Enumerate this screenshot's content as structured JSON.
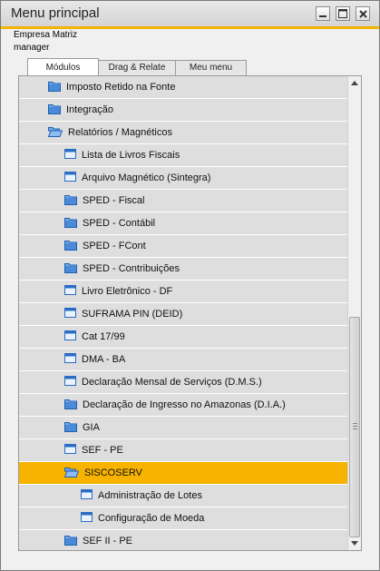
{
  "window": {
    "title": "Menu principal"
  },
  "info": {
    "company": "Empresa Matriz",
    "user": "manager"
  },
  "tabs": [
    {
      "label": "Módulos",
      "active": true
    },
    {
      "label": "Drag & Relate",
      "active": false
    },
    {
      "label": "Meu menu",
      "active": false
    }
  ],
  "tree": [
    {
      "label": "Imposto Retido na Fonte",
      "level": 1,
      "icon": "folder-icon"
    },
    {
      "label": "Integração",
      "level": 1,
      "icon": "folder-icon"
    },
    {
      "label": "Relatórios / Magnéticos",
      "level": 1,
      "icon": "folder-open-icon"
    },
    {
      "label": "Lista de Livros Fiscais",
      "level": 2,
      "icon": "form-icon"
    },
    {
      "label": "Arquivo Magnético (Sintegra)",
      "level": 2,
      "icon": "form-icon"
    },
    {
      "label": "SPED - Fiscal",
      "level": 2,
      "icon": "folder-icon"
    },
    {
      "label": "SPED - Contábil",
      "level": 2,
      "icon": "folder-icon"
    },
    {
      "label": "SPED - FCont",
      "level": 2,
      "icon": "folder-icon"
    },
    {
      "label": "SPED - Contribuições",
      "level": 2,
      "icon": "folder-icon"
    },
    {
      "label": "Livro Eletrônico - DF",
      "level": 2,
      "icon": "form-icon"
    },
    {
      "label": "SUFRAMA PIN (DEID)",
      "level": 2,
      "icon": "form-icon"
    },
    {
      "label": "Cat 17/99",
      "level": 2,
      "icon": "form-icon"
    },
    {
      "label": "DMA - BA",
      "level": 2,
      "icon": "form-icon"
    },
    {
      "label": "Declaração Mensal de Serviços (D.M.S.)",
      "level": 2,
      "icon": "form-icon"
    },
    {
      "label": "Declaração de Ingresso no Amazonas (D.I.A.)",
      "level": 2,
      "icon": "folder-icon"
    },
    {
      "label": "GIA",
      "level": 2,
      "icon": "folder-icon"
    },
    {
      "label": "SEF - PE",
      "level": 2,
      "icon": "form-icon"
    },
    {
      "label": "SISCOSERV",
      "level": 2,
      "icon": "folder-open-icon",
      "selected": true
    },
    {
      "label": "Administração de Lotes",
      "level": 3,
      "icon": "form-icon"
    },
    {
      "label": "Configuração de Moeda",
      "level": 3,
      "icon": "form-icon"
    },
    {
      "label": "SEF II - PE",
      "level": 2,
      "icon": "folder-icon"
    }
  ],
  "colors": {
    "accent": "#f7b300",
    "row": "#dedede",
    "icon_blue": "#2b6cc4"
  }
}
